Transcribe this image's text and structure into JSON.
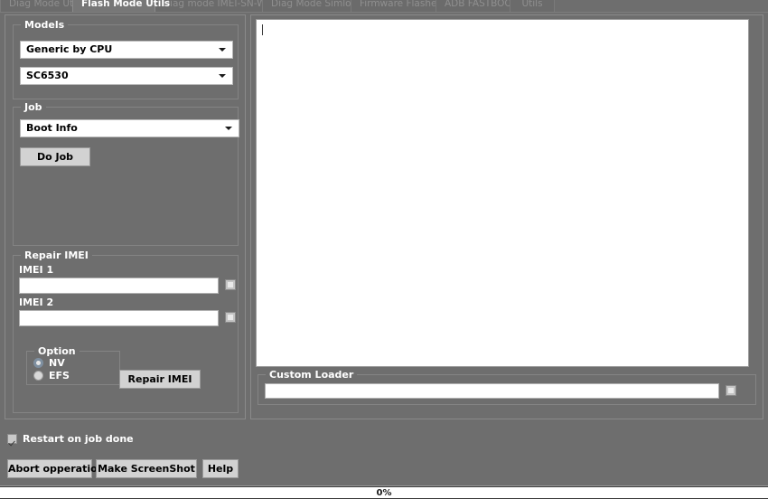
{
  "window": {
    "background_color": "#6e6e6e"
  },
  "tabs": [
    {
      "label": "Diag Mode Utils",
      "active": false
    },
    {
      "label": "Flash Mode Utils",
      "active": true
    },
    {
      "label": "Diag mode IMEI-SN-WIFI",
      "active": false
    },
    {
      "label": "Diag Mode Simlock",
      "active": false
    },
    {
      "label": "Firmware Flasher",
      "active": false
    },
    {
      "label": "ADB FASTBOOT",
      "active": false
    },
    {
      "label": "Utils",
      "active": false
    }
  ],
  "models_group": {
    "title": "Models",
    "brand_combo": {
      "value": "Generic by CPU",
      "icon": "chevron-down-icon"
    },
    "cpu_combo": {
      "value": "SC6530",
      "icon": "chevron-down-icon"
    }
  },
  "job_group": {
    "title": "Job",
    "job_combo": {
      "value": "Boot Info",
      "icon": "chevron-down-icon"
    },
    "do_job_button": "Do Job"
  },
  "repair_imei_group": {
    "title": "Repair IMEI",
    "imei1_label": "IMEI 1",
    "imei1_value": "",
    "imei1_placeholder": "",
    "imei1_toggle_icon": "square-toggle-icon",
    "imei2_label": "IMEI 2",
    "imei2_value": "",
    "imei2_placeholder": "",
    "imei2_toggle_icon": "square-toggle-icon",
    "option_group": {
      "title": "Option",
      "options": [
        {
          "label": "NV",
          "checked": true
        },
        {
          "label": "EFS",
          "checked": false
        }
      ]
    },
    "repair_button": "Repair IMEI"
  },
  "log": {
    "content": "",
    "caret_visible": true
  },
  "custom_loader_group": {
    "title": "Custom Loader",
    "path_value": "",
    "path_placeholder": "",
    "browse_icon": "square-toggle-icon"
  },
  "footer": {
    "restart_checkbox": {
      "label": "Restart on job done",
      "checked": true
    },
    "buttons": [
      {
        "label": "Abort opperation"
      },
      {
        "label": "Make ScreenShot"
      },
      {
        "label": "Help"
      }
    ]
  },
  "status": {
    "progress_percent": 0,
    "progress_text": "0%"
  }
}
